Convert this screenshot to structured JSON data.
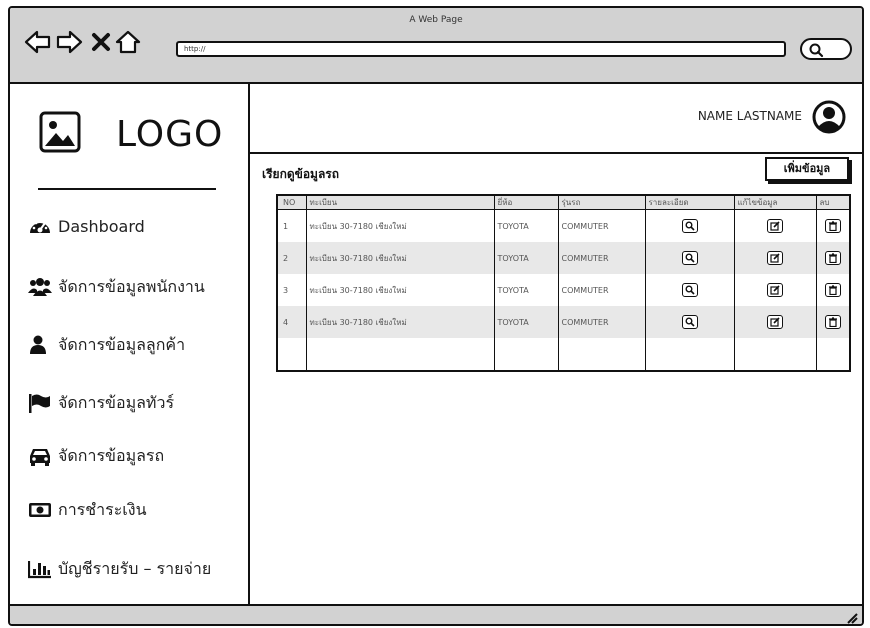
{
  "browser": {
    "page_caption": "A Web Page",
    "url": "http://",
    "icons": [
      "arrow-left-icon",
      "arrow-right-icon",
      "close-icon",
      "home-icon",
      "search-icon"
    ]
  },
  "sidebar": {
    "logo_text": "LOGO",
    "items": [
      {
        "label": "Dashboard",
        "icon": "dashboard-icon"
      },
      {
        "label": "จัดการข้อมูลพนักงาน",
        "icon": "users-icon"
      },
      {
        "label": "จัดการข้อมูลลูกค้า",
        "icon": "user-icon"
      },
      {
        "label": "จัดการข้อมูลทัวร์",
        "icon": "flag-icon"
      },
      {
        "label": "จัดการข้อมูลรถ",
        "icon": "car-icon"
      },
      {
        "label": "การชำระเงิน",
        "icon": "money-icon"
      },
      {
        "label": "บัญชีรายรับ – รายจ่าย",
        "icon": "bar-chart-icon"
      }
    ]
  },
  "header": {
    "username": "NAME LASTNAME"
  },
  "content": {
    "title": "เรียกดูข้อมูลรถ",
    "add_button": "เพิ่มข้อมูล",
    "table": {
      "columns": [
        "NO",
        "ทะเบียน",
        "ยี่ห้อ",
        "รุ่นรถ",
        "รายละเอียด",
        "แก้ไขข้อมูล",
        "ลบ"
      ],
      "rows": [
        {
          "no": "1",
          "plate": "ทะเบียน 30-7180 เชียงใหม่",
          "brand": "TOYOTA",
          "model": "COMMUTER"
        },
        {
          "no": "2",
          "plate": "ทะเบียน 30-7180 เชียงใหม่",
          "brand": "TOYOTA",
          "model": "COMMUTER"
        },
        {
          "no": "3",
          "plate": "ทะเบียน 30-7180 เชียงใหม่",
          "brand": "TOYOTA",
          "model": "COMMUTER"
        },
        {
          "no": "4",
          "plate": "ทะเบียน 30-7180 เชียงใหม่",
          "brand": "TOYOTA",
          "model": "COMMUTER"
        }
      ]
    }
  }
}
